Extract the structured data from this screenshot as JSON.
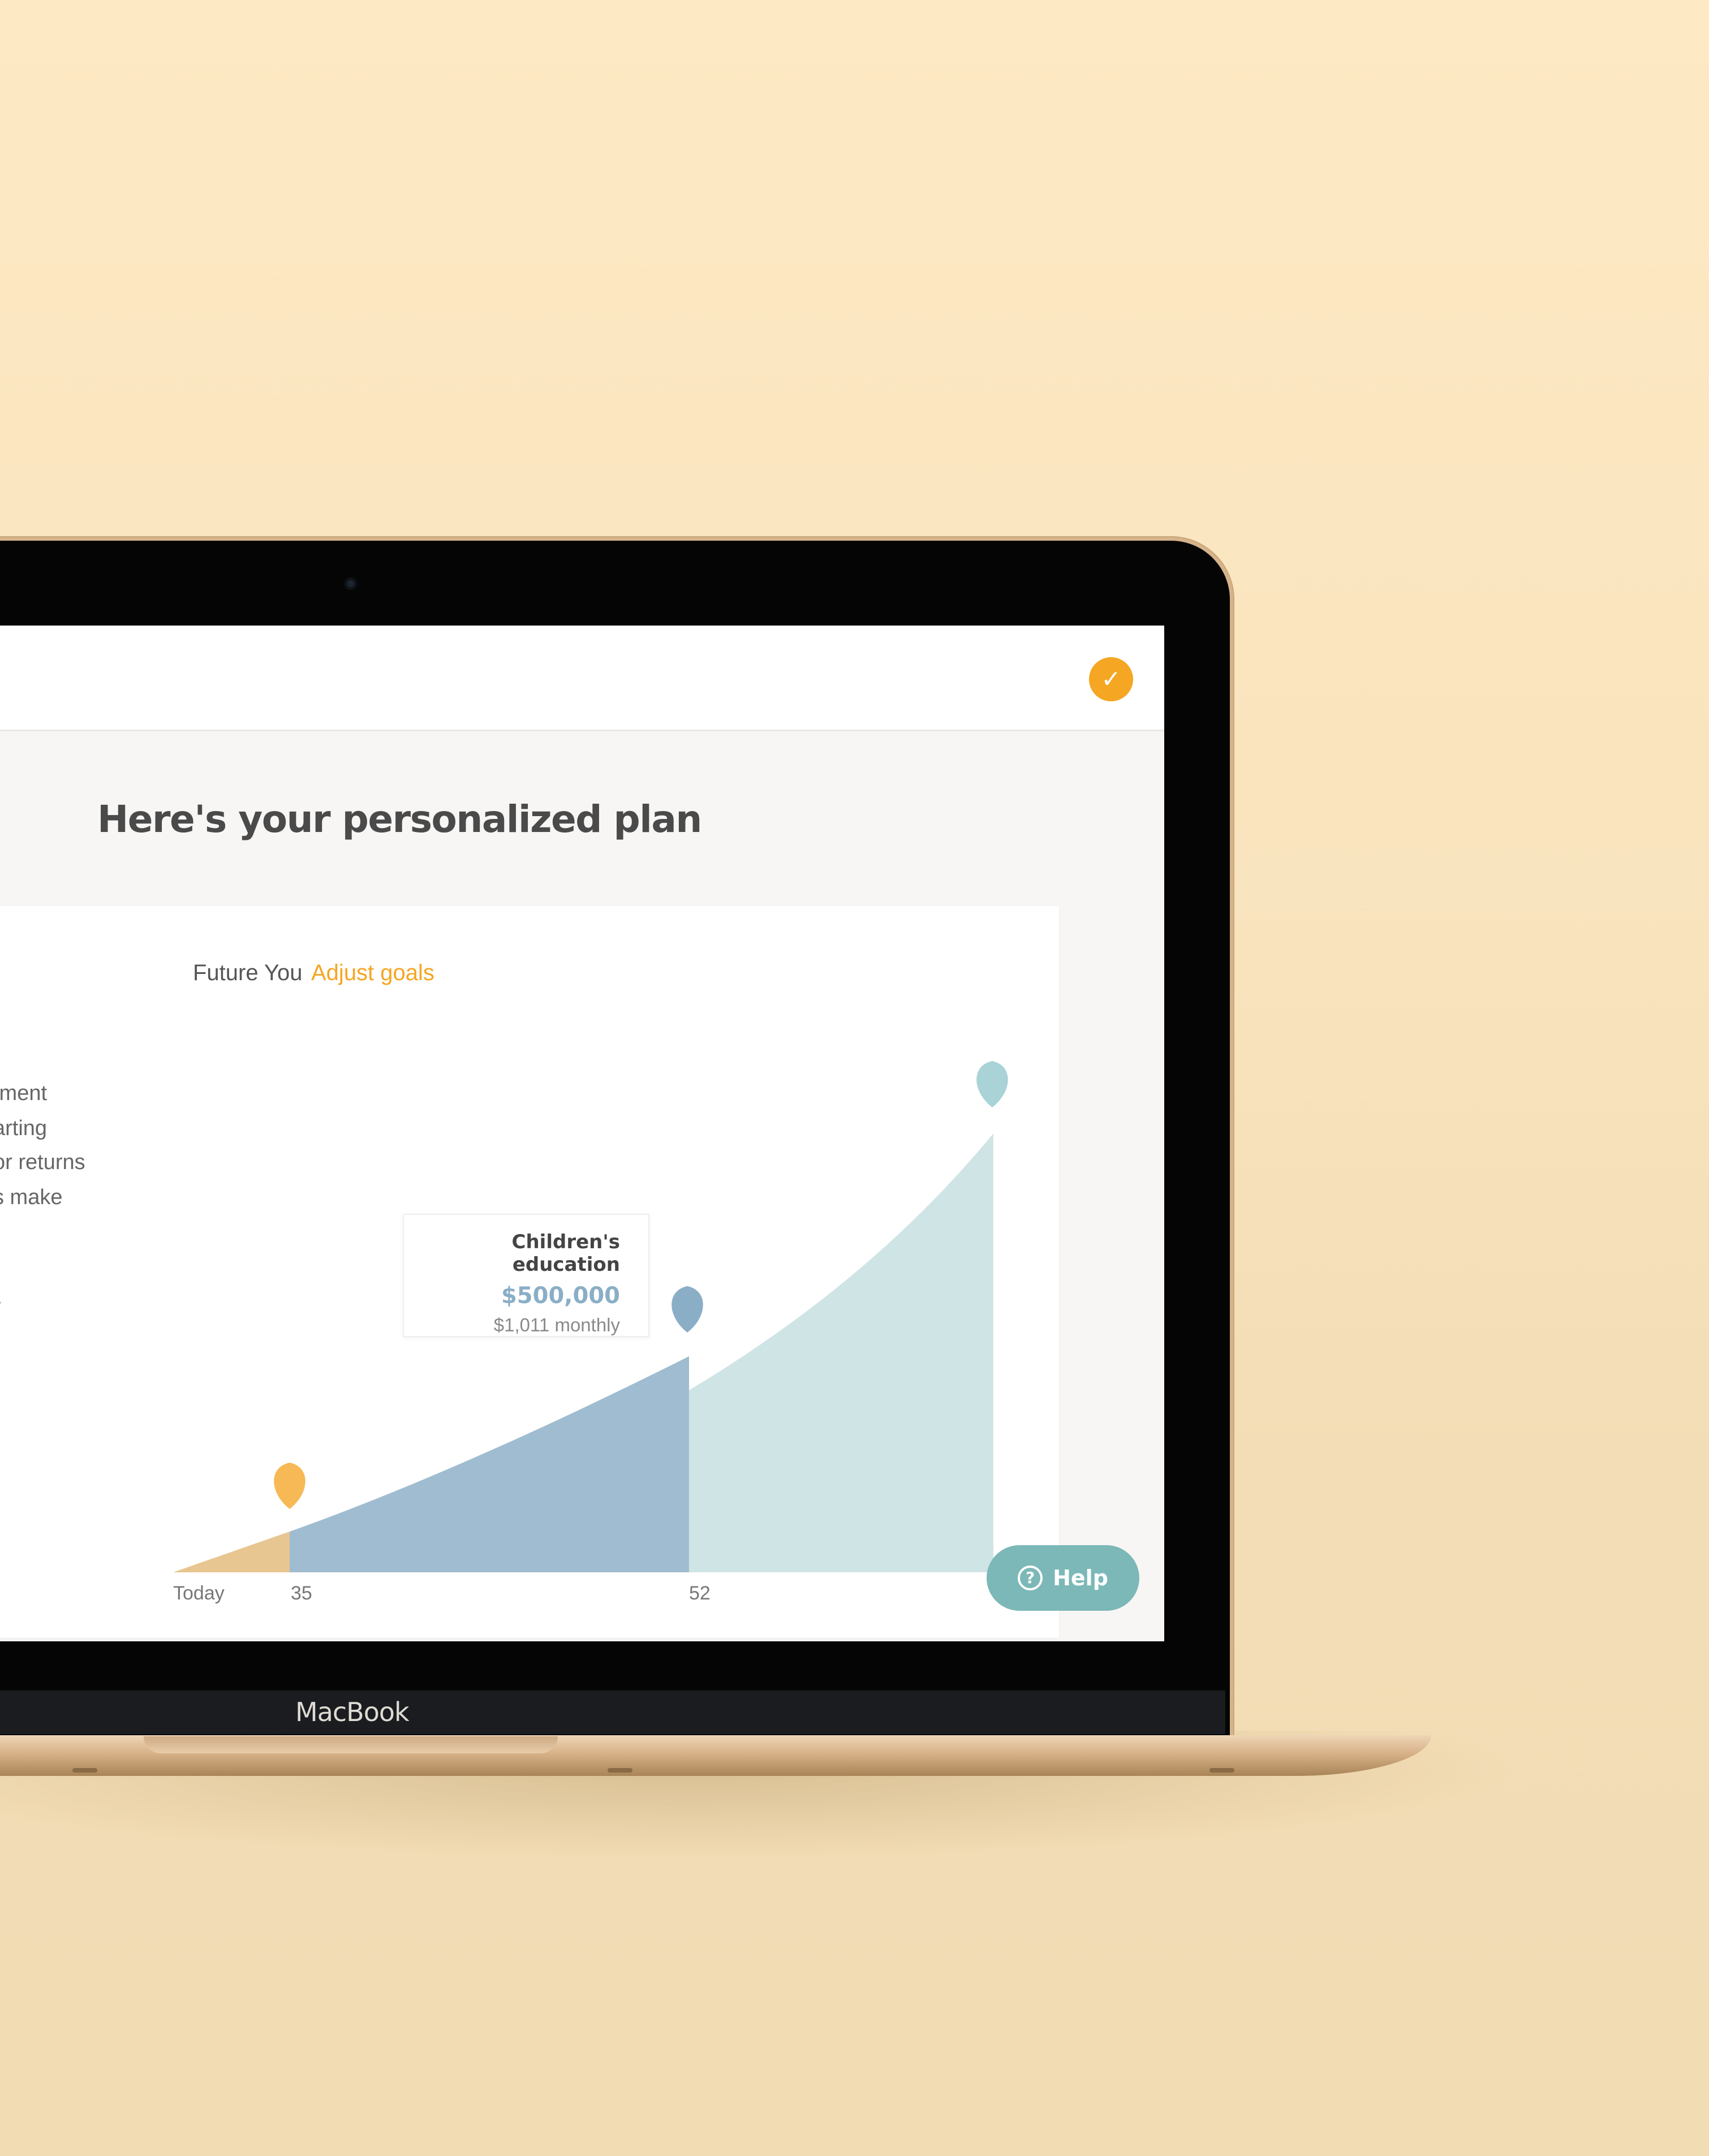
{
  "header": {
    "status_icon": "check-icon",
    "status_color": "#f5a623"
  },
  "page": {
    "title": "Here's your personalized plan"
  },
  "plan": {
    "future_label": "Future You",
    "adjust_link": "Adjust goals",
    "description_lines": [
      "tment",
      "arting",
      "or returns",
      "s make"
    ],
    "description_fragment": "/"
  },
  "tooltip": {
    "title": "Children's education",
    "amount": "$500,000",
    "monthly": "$1,011 monthly"
  },
  "help": {
    "label": "Help",
    "icon": "question-circle-icon"
  },
  "device": {
    "brand_label": "MacBook"
  },
  "colors": {
    "accent": "#f5a623",
    "teal": "#a9d3d6",
    "blue": "#8aaec6",
    "peach": "#fbd49a",
    "help": "#7cb8b8"
  },
  "chart_data": {
    "type": "area",
    "x_tick_labels": [
      "Today",
      "35",
      "52"
    ],
    "milestones": [
      {
        "label": "35",
        "marker_color": "#f7b955"
      },
      {
        "label": "52",
        "marker_color": "#8aaec6"
      },
      {
        "label": "",
        "marker_color": "#a9d3d6"
      }
    ],
    "grid": false
  }
}
